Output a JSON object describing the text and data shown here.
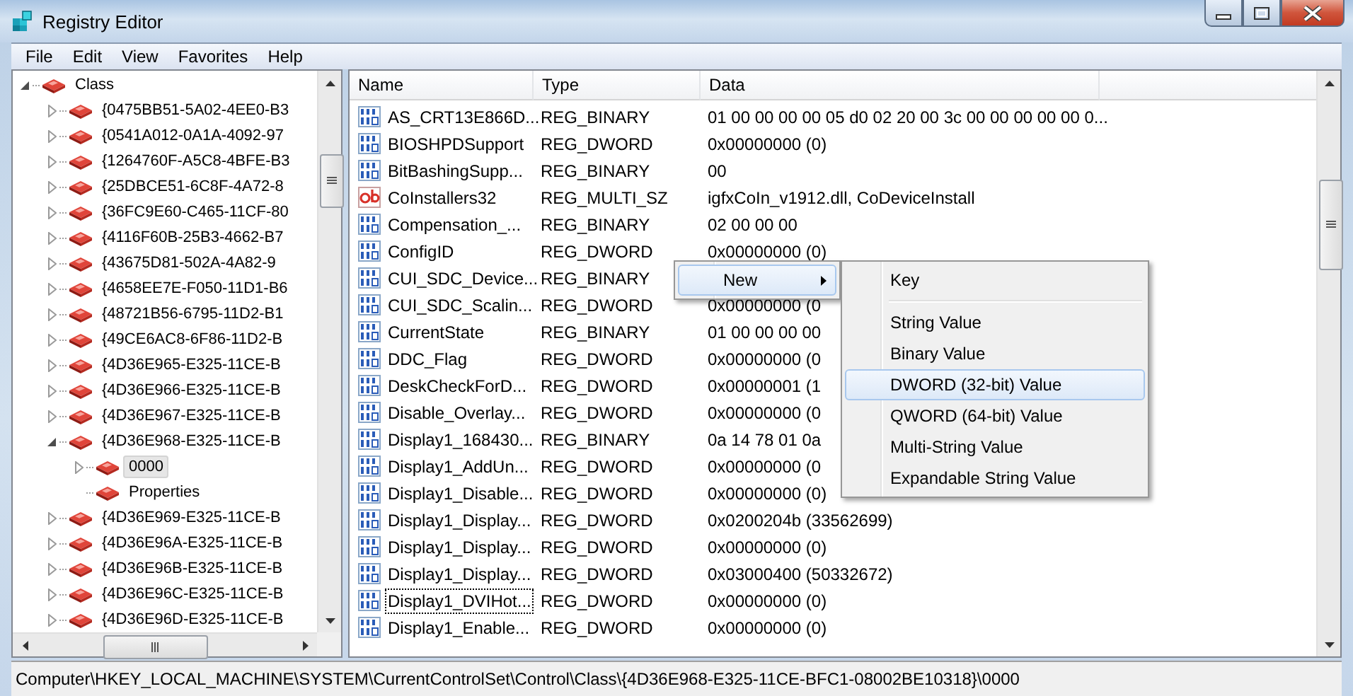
{
  "window": {
    "title": "Registry Editor"
  },
  "menu": [
    "File",
    "Edit",
    "View",
    "Favorites",
    "Help"
  ],
  "tree": [
    {
      "label": "Class",
      "expanded": true,
      "has_children": true,
      "selected": false,
      "children": [
        {
          "label": "{0475BB51-5A02-4EE0-B3",
          "expanded": false,
          "has_children": true,
          "selected": false
        },
        {
          "label": "{0541A012-0A1A-4092-97",
          "expanded": false,
          "has_children": true,
          "selected": false
        },
        {
          "label": "{1264760F-A5C8-4BFE-B3",
          "expanded": false,
          "has_children": true,
          "selected": false
        },
        {
          "label": "{25DBCE51-6C8F-4A72-8",
          "expanded": false,
          "has_children": true,
          "selected": false
        },
        {
          "label": "{36FC9E60-C465-11CF-80",
          "expanded": false,
          "has_children": true,
          "selected": false
        },
        {
          "label": "{4116F60B-25B3-4662-B7",
          "expanded": false,
          "has_children": true,
          "selected": false
        },
        {
          "label": "{43675D81-502A-4A82-9",
          "expanded": false,
          "has_children": true,
          "selected": false
        },
        {
          "label": "{4658EE7E-F050-11D1-B6",
          "expanded": false,
          "has_children": true,
          "selected": false
        },
        {
          "label": "{48721B56-6795-11D2-B1",
          "expanded": false,
          "has_children": true,
          "selected": false
        },
        {
          "label": "{49CE6AC8-6F86-11D2-B",
          "expanded": false,
          "has_children": true,
          "selected": false
        },
        {
          "label": "{4D36E965-E325-11CE-B",
          "expanded": false,
          "has_children": true,
          "selected": false
        },
        {
          "label": "{4D36E966-E325-11CE-B",
          "expanded": false,
          "has_children": true,
          "selected": false
        },
        {
          "label": "{4D36E967-E325-11CE-B",
          "expanded": false,
          "has_children": true,
          "selected": false
        },
        {
          "label": "{4D36E968-E325-11CE-B",
          "expanded": true,
          "has_children": true,
          "selected": false,
          "children": [
            {
              "label": "0000",
              "expanded": false,
              "has_children": true,
              "selected": true
            },
            {
              "label": "Properties",
              "expanded": false,
              "has_children": false,
              "selected": false
            }
          ]
        },
        {
          "label": "{4D36E969-E325-11CE-B",
          "expanded": false,
          "has_children": true,
          "selected": false
        },
        {
          "label": "{4D36E96A-E325-11CE-B",
          "expanded": false,
          "has_children": true,
          "selected": false
        },
        {
          "label": "{4D36E96B-E325-11CE-B",
          "expanded": false,
          "has_children": true,
          "selected": false
        },
        {
          "label": "{4D36E96C-E325-11CE-B",
          "expanded": false,
          "has_children": true,
          "selected": false
        },
        {
          "label": "{4D36E96D-E325-11CE-B",
          "expanded": false,
          "has_children": true,
          "selected": false
        }
      ]
    }
  ],
  "table": {
    "columns": [
      "Name",
      "Type",
      "Data"
    ],
    "rows": [
      {
        "kind": "binary",
        "name": "AS_CRT13E866D...",
        "type": "REG_BINARY",
        "data": "01 00 00 00 00 05 d0 02 20 00 3c 00 00 00 00 00 0...",
        "focused": false
      },
      {
        "kind": "binary",
        "name": "BIOSHPDSupport",
        "type": "REG_DWORD",
        "data": "0x00000000 (0)",
        "focused": false
      },
      {
        "kind": "binary",
        "name": "BitBashingSupp...",
        "type": "REG_BINARY",
        "data": "00",
        "focused": false
      },
      {
        "kind": "string",
        "name": "CoInstallers32",
        "type": "REG_MULTI_SZ",
        "data": "igfxCoIn_v1912.dll, CoDeviceInstall",
        "focused": false
      },
      {
        "kind": "binary",
        "name": "Compensation_...",
        "type": "REG_BINARY",
        "data": "02 00 00 00",
        "focused": false
      },
      {
        "kind": "binary",
        "name": "ConfigID",
        "type": "REG_DWORD",
        "data": "0x00000000 (0)",
        "focused": false
      },
      {
        "kind": "binary",
        "name": "CUI_SDC_Device...",
        "type": "REG_BINARY",
        "focused": false
      },
      {
        "kind": "binary",
        "name": "CUI_SDC_Scalin...",
        "type": "REG_DWORD",
        "data": "0x00000000 (0",
        "focused": false
      },
      {
        "kind": "binary",
        "name": "CurrentState",
        "type": "REG_BINARY",
        "data": "01 00 00 00 00",
        "focused": false
      },
      {
        "kind": "binary",
        "name": "DDC_Flag",
        "type": "REG_DWORD",
        "data": "0x00000000 (0",
        "focused": false
      },
      {
        "kind": "binary",
        "name": "DeskCheckForD...",
        "type": "REG_DWORD",
        "data": "0x00000001 (1",
        "focused": false
      },
      {
        "kind": "binary",
        "name": "Disable_Overlay...",
        "type": "REG_DWORD",
        "data": "0x00000000 (0",
        "focused": false
      },
      {
        "kind": "binary",
        "name": "Display1_168430...",
        "type": "REG_BINARY",
        "data": "0a 14 78 01 0a",
        "focused": false
      },
      {
        "kind": "binary",
        "name": "Display1_AddUn...",
        "type": "REG_DWORD",
        "data": "0x00000000 (0",
        "focused": false
      },
      {
        "kind": "binary",
        "name": "Display1_Disable...",
        "type": "REG_DWORD",
        "data": "0x00000000 (0)",
        "focused": false
      },
      {
        "kind": "binary",
        "name": "Display1_Display...",
        "type": "REG_DWORD",
        "data": "0x0200204b (33562699)",
        "focused": false
      },
      {
        "kind": "binary",
        "name": "Display1_Display...",
        "type": "REG_DWORD",
        "data": "0x00000000 (0)",
        "focused": false
      },
      {
        "kind": "binary",
        "name": "Display1_Display...",
        "type": "REG_DWORD",
        "data": "0x03000400 (50332672)",
        "focused": false
      },
      {
        "kind": "binary",
        "name": "Display1_DVIHot...",
        "type": "REG_DWORD",
        "data": "0x00000000 (0)",
        "focused": true
      },
      {
        "kind": "binary",
        "name": "Display1_Enable...",
        "type": "REG_DWORD",
        "data": "0x00000000 (0)",
        "focused": false
      }
    ]
  },
  "context_menu": {
    "items": [
      {
        "label": "New",
        "selected": true,
        "submenu": true
      }
    ]
  },
  "submenu": {
    "items": [
      {
        "kind": "item",
        "label": "Key",
        "selected": false
      },
      {
        "kind": "separator"
      },
      {
        "kind": "item",
        "label": "String Value",
        "selected": false
      },
      {
        "kind": "item",
        "label": "Binary Value",
        "selected": false
      },
      {
        "kind": "item",
        "label": "DWORD (32-bit) Value",
        "selected": true
      },
      {
        "kind": "item",
        "label": "QWORD (64-bit) Value",
        "selected": false
      },
      {
        "kind": "item",
        "label": "Multi-String Value",
        "selected": false
      },
      {
        "kind": "item",
        "label": "Expandable String Value",
        "selected": false
      }
    ]
  },
  "status_bar": "Computer\\HKEY_LOCAL_MACHINE\\SYSTEM\\CurrentControlSet\\Control\\Class\\{4D36E968-E325-11CE-BFC1-08002BE10318}\\0000"
}
